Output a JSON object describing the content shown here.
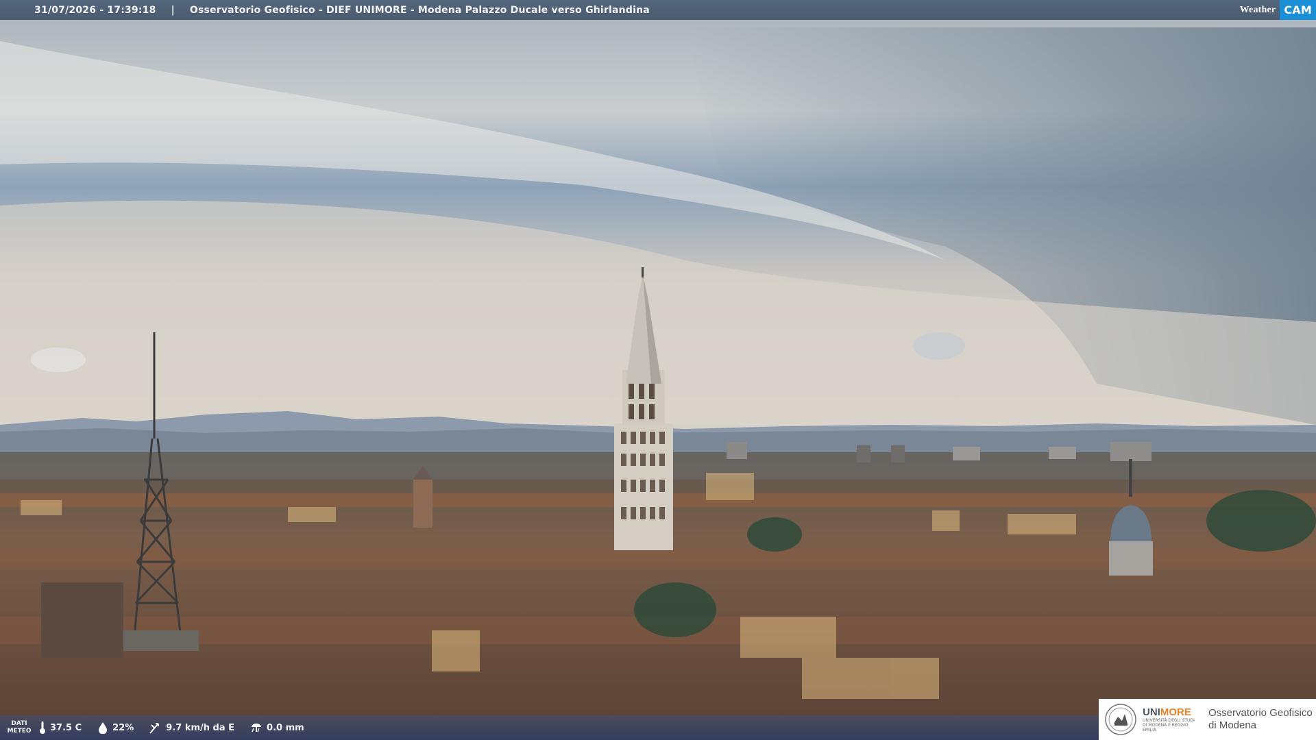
{
  "header": {
    "timestamp": "31/07/2026 - 17:39:18",
    "separator": "|",
    "camera_title": "Osservatorio Geofisico - DIEF UNIMORE - Modena Palazzo Ducale verso Ghirlandina"
  },
  "logo": {
    "weather": "Weather",
    "cam": "CAM"
  },
  "weather_data": {
    "label_line1": "DATI",
    "label_line2": "METEO",
    "temperature": "37.5 C",
    "humidity": "22%",
    "wind": "9.7 km/h da E",
    "rain": "0.0 mm",
    "icons": [
      "thermometer-icon",
      "humidity-icon",
      "wind-icon",
      "rain-icon"
    ]
  },
  "footer_logo": {
    "brand_prefix": "UNI",
    "brand_suffix": "MORE",
    "university": "UNIVERSITÀ DEGLI STUDI DI MODENA E REGGIO EMILIA",
    "observatory_line1": "Osservatorio Geofisico",
    "observatory_line2": "di Modena"
  },
  "colors": {
    "accent": "#1b8fd6",
    "brand_orange": "#e5842b",
    "topbar": "#4f6176"
  }
}
